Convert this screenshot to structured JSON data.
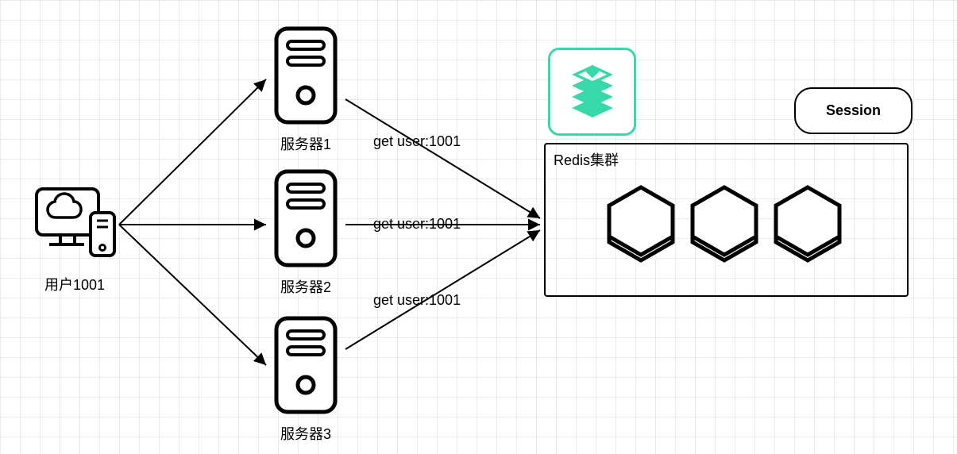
{
  "user": {
    "label": "用户1001"
  },
  "servers": [
    {
      "label": "服务器1"
    },
    {
      "label": "服务器2"
    },
    {
      "label": "服务器3"
    }
  ],
  "edges": {
    "req1": "get user:1001",
    "req2": "get user:1001",
    "req3": "get user:1001"
  },
  "redis": {
    "title": "Redis集群"
  },
  "session": {
    "label": "Session"
  }
}
